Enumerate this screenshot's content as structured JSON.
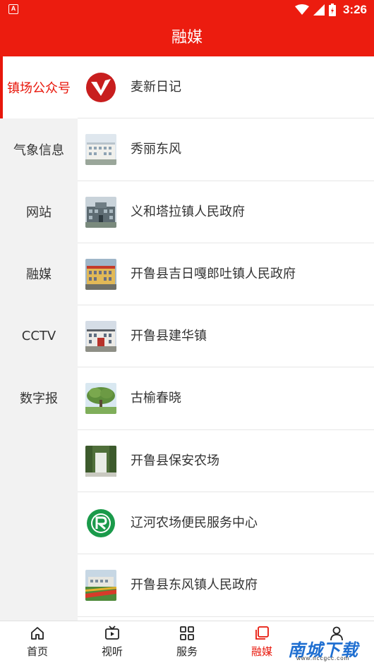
{
  "status": {
    "time": "3:26",
    "badge": "A"
  },
  "header": {
    "title": "融媒"
  },
  "sidebar": {
    "items": [
      {
        "label": "镇场公众号"
      },
      {
        "label": "气象信息"
      },
      {
        "label": "网站"
      },
      {
        "label": "融媒"
      },
      {
        "label": "CCTV"
      },
      {
        "label": "数字报"
      }
    ]
  },
  "list": {
    "items": [
      {
        "label": "麦新日记"
      },
      {
        "label": "秀丽东风"
      },
      {
        "label": "义和塔拉镇人民政府"
      },
      {
        "label": "开鲁县吉日嘎郎吐镇人民政府"
      },
      {
        "label": "开鲁县建华镇"
      },
      {
        "label": "古榆春晓"
      },
      {
        "label": "开鲁县保安农场"
      },
      {
        "label": "辽河农场便民服务中心"
      },
      {
        "label": "开鲁县东风镇人民政府"
      }
    ]
  },
  "tabbar": {
    "items": [
      {
        "label": "首页",
        "icon": "home-icon"
      },
      {
        "label": "视听",
        "icon": "tv-icon"
      },
      {
        "label": "服务",
        "icon": "grid-icon"
      },
      {
        "label": "融媒",
        "icon": "media-icon"
      },
      {
        "label": "",
        "icon": "user-icon"
      }
    ]
  },
  "watermark": {
    "text": "南城下载",
    "sub": "www.nccgcc.com"
  },
  "colors": {
    "brand": "#ec1c0f",
    "accent": "#e8170b",
    "sidebar_bg": "#f2f2f2"
  }
}
